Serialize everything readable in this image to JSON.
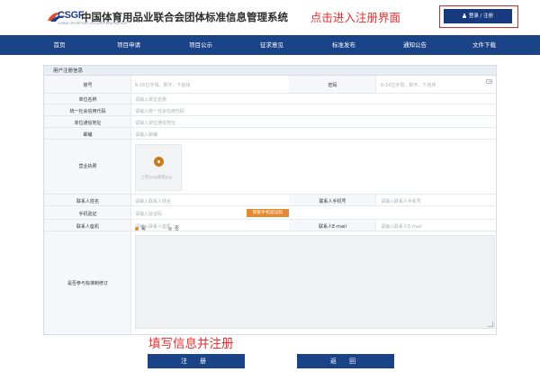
{
  "header": {
    "logo_text": "CSGF",
    "logo_sub": "CHINA SPORTING GOODS FEDERATION",
    "site_title": "中国体育用品业联合会团体标准信息管理系统",
    "annotation": "点击进入注册界面",
    "login_label": "登录 / 注册"
  },
  "nav": {
    "items": [
      {
        "label": "首页"
      },
      {
        "label": "项目申请"
      },
      {
        "label": "项目公示"
      },
      {
        "label": "征求意见"
      },
      {
        "label": "标准发布"
      },
      {
        "label": "通知公告"
      },
      {
        "label": "文件下载"
      }
    ]
  },
  "form": {
    "title": "用户注册信息",
    "account_label": "账号",
    "account_placeholder": "6-16位字母、数字、下划线",
    "password_label": "密码",
    "password_placeholder": "6-16位字母、数字、下划线",
    "unit_name_label": "单位名称",
    "unit_name_placeholder": "请输入单位名称",
    "credit_code_label": "统一社会信用代码",
    "credit_code_placeholder": "请输入统一社会信用代码",
    "address_label": "单位通信地址",
    "address_placeholder": "请输入单位通信地址",
    "postcode_label": "邮编",
    "postcode_placeholder": "请输入邮编",
    "license_label": "营业执照",
    "license_upload_text": "上传jpeg或者jpg",
    "contact_name_label": "联系人姓名",
    "contact_name_placeholder": "请输入联系人姓名",
    "contact_mobile_label": "联系人手机号",
    "contact_mobile_placeholder": "请输入联系人手机号",
    "sms_label": "手机验证",
    "sms_placeholder": "请输入验证码",
    "sms_button": "获取手机验证码",
    "contact_phone_label": "联系人座机",
    "contact_phone_placeholder": "请输入联系人座机",
    "contact_email_label": "联系人E-mail",
    "contact_email_placeholder": "请输入联系人E-mail",
    "participate_label": "是否参与标准制修订",
    "option_yes": "是",
    "option_no": "否",
    "selected_option": "是"
  },
  "footer": {
    "annotation": "填写信息并注册",
    "register_label": "注 册",
    "back_label": "返 回"
  },
  "colors": {
    "nav_bg": "#1b4388",
    "accent_orange": "#e58a2e",
    "annotation_red": "#e62e2e"
  }
}
